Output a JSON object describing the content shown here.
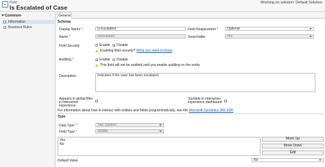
{
  "header": {
    "entity_label": "Field",
    "title": "Is Escalated of Case",
    "solution": "Working on solution: Default Solution"
  },
  "sidebar": {
    "section": "Common",
    "items": [
      {
        "label": "Information",
        "active": true
      },
      {
        "label": "Business Rules",
        "active": false
      }
    ]
  },
  "tabs": [
    {
      "label": "General"
    }
  ],
  "schema": {
    "heading": "Schema",
    "display_name_label": "Display Name",
    "display_name_value": "Is Escalated",
    "name_label": "Name",
    "name_value": "isescalated",
    "field_requirement_label": "Field Requirement",
    "field_requirement_value": "Optional",
    "searchable_label": "Searchable",
    "searchable_value": "Yes",
    "field_security_label": "Field Security",
    "field_security_enable": "Enable",
    "field_security_disable": "Disable",
    "field_security_note": "Enabling field security?",
    "field_security_link": "What you need to know",
    "auditing_label": "Auditing",
    "auditing_enable": "Enable",
    "auditing_disable": "Disable",
    "auditing_note": "This field will not be audited until you enable auditing on the entity.",
    "description_label": "Description",
    "description_value": "Indicates if the case has been escalated.",
    "global_filter_label": "Appears in global filter in interactive experience",
    "sortable_label": "Sortable in interactive experience dashboard",
    "info_text": "For information about how to interact with entities and fields programmatically, see the",
    "info_link": "Microsoft Dynamics 365 SDK"
  },
  "type": {
    "heading": "Type",
    "data_type_label": "Data Type",
    "data_type_value": "Two Options",
    "field_type_label": "Field Type",
    "field_type_value": "Simple",
    "options": [
      "Yes",
      "No"
    ],
    "move_up": "Move Up",
    "move_down": "Move Down",
    "edit": "Edit",
    "default_value_label": "Default Value",
    "default_value": "No"
  }
}
